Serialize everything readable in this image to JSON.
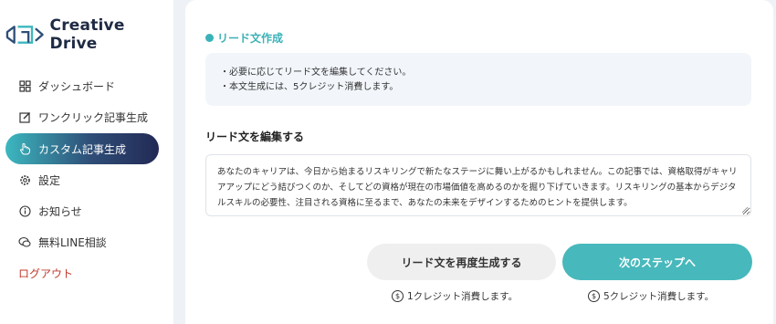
{
  "brand": {
    "name": "Creative Drive"
  },
  "sidebar": {
    "items": [
      {
        "label": "ダッシュボード",
        "icon": "dashboard-grid-icon"
      },
      {
        "label": "ワンクリック記事生成",
        "icon": "edit-icon"
      },
      {
        "label": "カスタム記事生成",
        "icon": "pointer-hand-icon",
        "active": true
      },
      {
        "label": "設定",
        "icon": "gear-icon"
      },
      {
        "label": "お知らせ",
        "icon": "info-icon"
      },
      {
        "label": "無料LINE相談",
        "icon": "chat-icon"
      },
      {
        "label": "ログアウト"
      }
    ]
  },
  "main": {
    "section_title": "リード文作成",
    "notes": [
      "・必要に応じてリード文を編集してください。",
      "・本文生成には、5クレジット消費します。"
    ],
    "edit_label": "リード文を編集する",
    "lead_text": "あなたのキャリアは、今日から始まるリスキリングで新たなステージに舞い上がるかもしれません。この記事では、資格取得がキャリアアップにどう結びつくのか、そしてどの資格が現在の市場価値を高めるのかを掘り下げていきます。リスキリングの基本からデジタルスキルの必要性、注目される資格に至るまで、あなたの未来をデザインするためのヒントを提供します。",
    "buttons": {
      "regenerate": "リード文を再度生成する",
      "next": "次のステップへ"
    },
    "costs": {
      "regenerate": "1クレジット消費します。",
      "next": "5クレジット消費します。"
    }
  },
  "colors": {
    "accent": "#47b8bc",
    "active_gradient_start": "#3cb8bf",
    "active_gradient_end": "#222a55",
    "logout": "#c0392b",
    "background": "#eef1f6"
  }
}
